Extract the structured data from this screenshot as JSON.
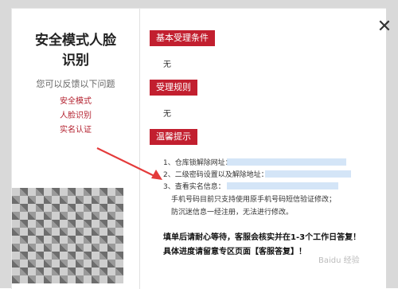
{
  "left": {
    "title_line1": "安全模式人脸",
    "title_line2": "识别",
    "subtitle": "您可以反馈以下问题",
    "links": [
      "安全模式",
      "人脸识别",
      "实名认证"
    ]
  },
  "sections": [
    {
      "button": "基本受理条件",
      "text": "无"
    },
    {
      "button": "受理规则",
      "text": "无"
    },
    {
      "button": "温馨提示"
    }
  ],
  "tips": [
    "1、仓库锁解除网址：",
    "2、二级密码设置以及解除地址：",
    "3、查看实名信息：",
    "手机号码目前只支持使用原手机号码短信验证修改；",
    "防沉迷信息一经注册，无法进行修改。"
  ],
  "notice": [
    "填单后请耐心等待，客服会核实并在1-3个工作日答复！",
    "具体进度请留意专区页面【客服答复】！"
  ],
  "close_icon": "close-icon",
  "colors": {
    "accent": "#c21f2f"
  },
  "watermark": "Baidu 经验"
}
